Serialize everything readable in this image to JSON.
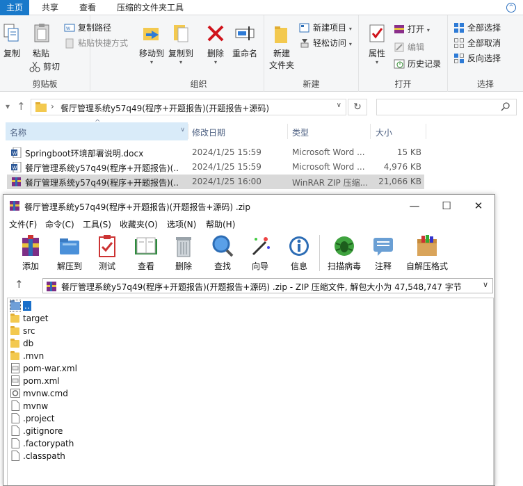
{
  "ribbon": {
    "tabs": [
      "主页",
      "共享",
      "查看",
      "压缩的文件夹工具"
    ],
    "groups": {
      "clipboard": {
        "label": "剪贴板",
        "copy": "复制",
        "paste": "粘贴",
        "copy_path": "复制路径",
        "paste_shortcut": "粘贴快捷方式",
        "cut": "剪切"
      },
      "organize": {
        "label": "组织",
        "move_to": "移动到",
        "copy_to": "复制到",
        "delete": "删除",
        "rename": "重命名"
      },
      "new": {
        "label": "新建",
        "new_folder_line1": "新建",
        "new_folder_line2": "文件夹",
        "new_item": "新建项目",
        "easy_access": "轻松访问"
      },
      "open": {
        "label": "打开",
        "properties": "属性",
        "open": "打开",
        "edit": "编辑",
        "history": "历史记录"
      },
      "select": {
        "label": "选择",
        "select_all": "全部选择",
        "select_none": "全部取消",
        "invert": "反向选择"
      }
    }
  },
  "address": {
    "path": "餐厅管理系统y57q49(程序+开题报告)(开题报告+源码)"
  },
  "columns": {
    "name": "名称",
    "modified": "修改日期",
    "type": "类型",
    "size": "大小"
  },
  "files": [
    {
      "name": "Springboot环境部署说明.docx",
      "modified": "2024/1/25 15:59",
      "type": "Microsoft Word ...",
      "size": "15 KB",
      "icon": "word-doc-icon"
    },
    {
      "name": "餐厅管理系统y57q49(程序+开题报告)(...",
      "modified": "2024/1/25 15:59",
      "type": "Microsoft Word ...",
      "size": "4,976 KB",
      "icon": "word-doc-icon"
    },
    {
      "name": "餐厅管理系统y57q49(程序+开题报告)(...",
      "modified": "2024/1/25 16:00",
      "type": "WinRAR ZIP 压缩...",
      "size": "21,066 KB",
      "icon": "winrar-icon"
    }
  ],
  "rar": {
    "title": "餐厅管理系统y57q49(程序+开题报告)(开题报告+源码) .zip",
    "menu": [
      "文件(F)",
      "命令(C)",
      "工具(S)",
      "收藏夹(O)",
      "选项(N)",
      "帮助(H)"
    ],
    "toolbar": [
      "添加",
      "解压到",
      "测试",
      "查看",
      "删除",
      "查找",
      "向导",
      "信息",
      "扫描病毒",
      "注释",
      "自解压格式"
    ],
    "path": "餐厅管理系统y57q49(程序+开题报告)(开题报告+源码) .zip - ZIP 压缩文件, 解包大小为 47,548,747 字节",
    "entries": [
      {
        "name": "..",
        "kind": "up-folder"
      },
      {
        "name": "target",
        "kind": "folder"
      },
      {
        "name": "src",
        "kind": "folder"
      },
      {
        "name": "db",
        "kind": "folder"
      },
      {
        "name": ".mvn",
        "kind": "folder"
      },
      {
        "name": "pom-war.xml",
        "kind": "xml"
      },
      {
        "name": "pom.xml",
        "kind": "xml"
      },
      {
        "name": "mvnw.cmd",
        "kind": "cmd"
      },
      {
        "name": "mvnw",
        "kind": "file"
      },
      {
        "name": ".project",
        "kind": "file"
      },
      {
        "name": ".gitignore",
        "kind": "file"
      },
      {
        "name": ".factorypath",
        "kind": "file"
      },
      {
        "name": ".classpath",
        "kind": "file"
      }
    ]
  },
  "colors": {
    "accent": "#1979ca",
    "selection": "#d9d9d9",
    "rar_selection": "#1a6fc9"
  }
}
